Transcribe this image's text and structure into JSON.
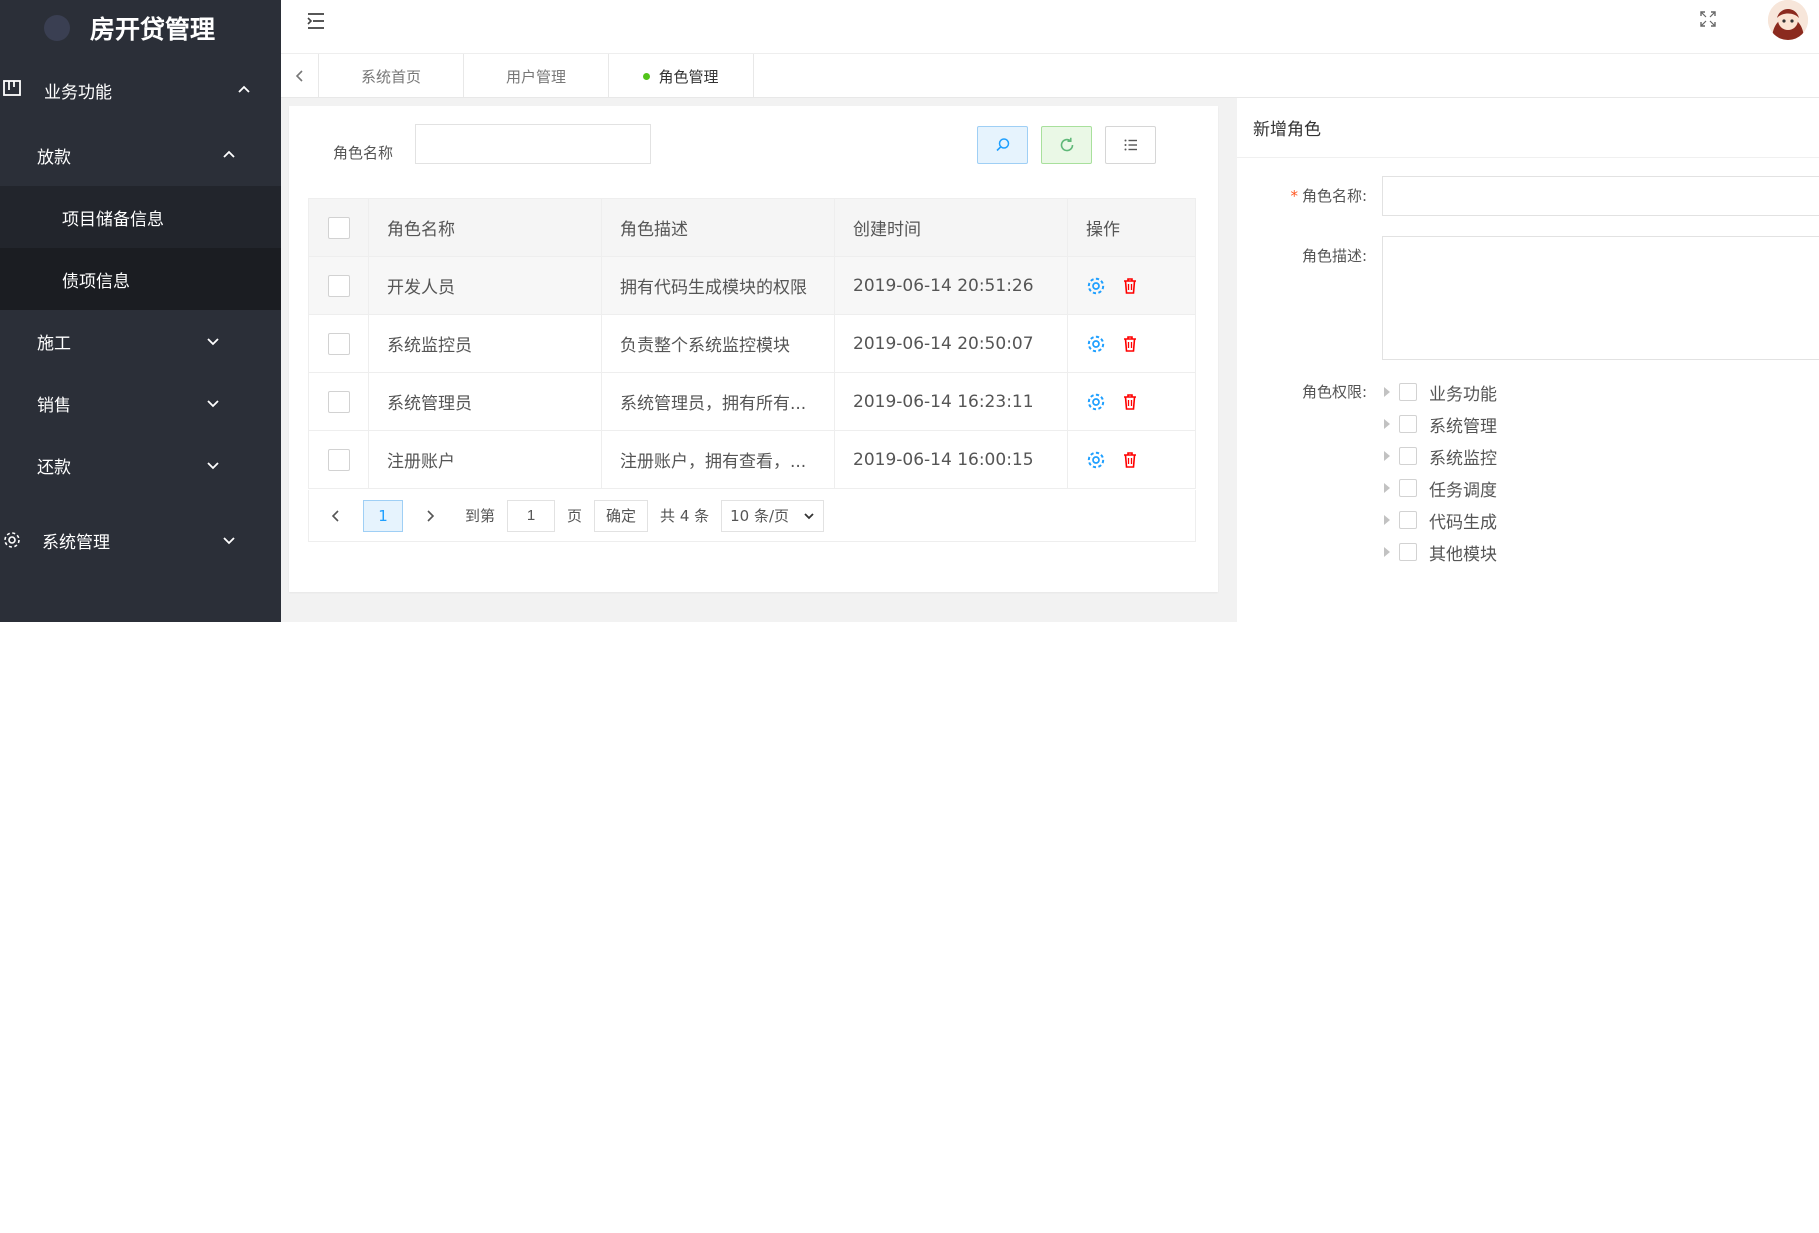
{
  "app": {
    "title": "房开贷管理"
  },
  "sidebar": {
    "groups": [
      {
        "label": "业务功能",
        "icon": "board-icon",
        "expanded": true
      },
      {
        "label": "系统管理",
        "icon": "gear-icon",
        "expanded": false
      }
    ],
    "sub_menus": [
      {
        "label": "放款",
        "expanded": true,
        "items": [
          "项目储备信息",
          "债项信息"
        ],
        "active": "债项信息"
      },
      {
        "label": "施工",
        "expanded": false
      },
      {
        "label": "销售",
        "expanded": false
      },
      {
        "label": "还款",
        "expanded": false
      }
    ]
  },
  "tabs": [
    {
      "label": "系统首页",
      "active": false
    },
    {
      "label": "用户管理",
      "active": false
    },
    {
      "label": "角色管理",
      "active": true
    }
  ],
  "search": {
    "label": "角色名称",
    "value": ""
  },
  "table": {
    "columns": [
      "角色名称",
      "角色描述",
      "创建时间",
      "操作"
    ],
    "rows": [
      {
        "name": "开发人员",
        "desc": "拥有代码生成模块的权限",
        "time": "2019-06-14 20:51:26"
      },
      {
        "name": "系统监控员",
        "desc": "负责整个系统监控模块",
        "time": "2019-06-14 20:50:07"
      },
      {
        "name": "系统管理员",
        "desc": "系统管理员，拥有所有...",
        "time": "2019-06-14 16:23:11"
      },
      {
        "name": "注册账户",
        "desc": "注册账户，拥有查看，...",
        "time": "2019-06-14 16:00:15"
      }
    ]
  },
  "pager": {
    "current": "1",
    "goto_label": "到第",
    "goto_value": "1",
    "page_label": "页",
    "confirm": "确定",
    "total": "共 4 条",
    "page_size": "10 条/页"
  },
  "form": {
    "title": "新增角色",
    "name_label": "角色名称:",
    "desc_label": "角色描述:",
    "perm_label": "角色权限:",
    "permissions": [
      "业务功能",
      "系统管理",
      "系统监控",
      "任务调度",
      "代码生成",
      "其他模块"
    ]
  },
  "colors": {
    "sidebar_bg": "#2b2f38",
    "accent_blue": "#1e9fff",
    "accent_green": "#5fb878",
    "danger_red": "#ff0000",
    "tab_dot": "#52c41a"
  }
}
